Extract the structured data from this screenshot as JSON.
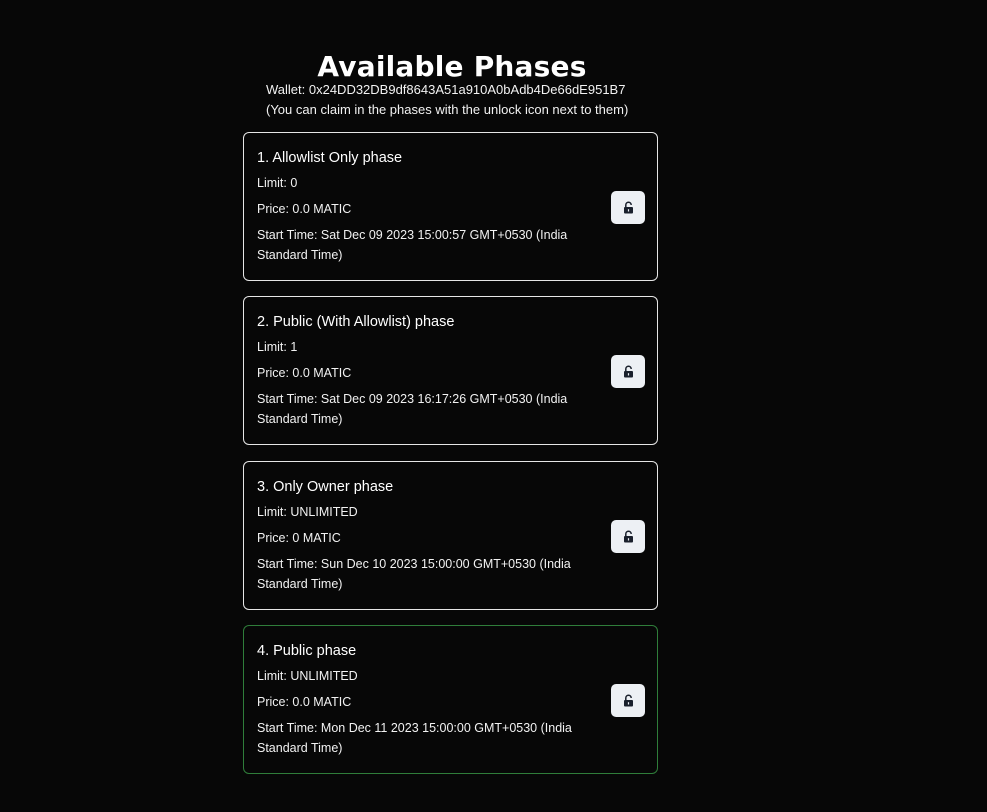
{
  "page": {
    "title": "Available Phases",
    "wallet_label": "Wallet: 0x24DD32DB9df8643A51a910A0bAdb4De66dE951B7",
    "hint": "(You can claim in the phases with the unlock icon next to them)"
  },
  "phases": [
    {
      "name": "1. Allowlist Only phase",
      "limit": "Limit: 0",
      "price": "Price: 0.0 MATIC",
      "start_time": "Start Time: Sat Dec 09 2023 15:00:57 GMT+0530 (India Standard Time)",
      "icon": "unlock-icon"
    },
    {
      "name": "2. Public (With Allowlist) phase",
      "limit": "Limit: 1",
      "price": "Price: 0.0 MATIC",
      "start_time": "Start Time: Sat Dec 09 2023 16:17:26 GMT+0530 (India Standard Time)",
      "icon": "unlock-icon"
    },
    {
      "name": "3. Only Owner phase",
      "limit": "Limit: UNLIMITED",
      "price": "Price: 0 MATIC",
      "start_time": "Start Time: Sun Dec 10 2023 15:00:00 GMT+0530 (India Standard Time)",
      "icon": "unlock-icon"
    },
    {
      "name": "4. Public phase",
      "limit": "Limit: UNLIMITED",
      "price": "Price: 0.0 MATIC",
      "start_time": "Start Time: Mon Dec 11 2023 15:00:00 GMT+0530 (India Standard Time)",
      "icon": "unlock-icon"
    }
  ],
  "colors": {
    "background": "#070707",
    "card_border": "#e6e6e6",
    "active_card_border": "#2f7d3a",
    "button_background": "#edf0f4",
    "icon_color": "#1a202c"
  }
}
